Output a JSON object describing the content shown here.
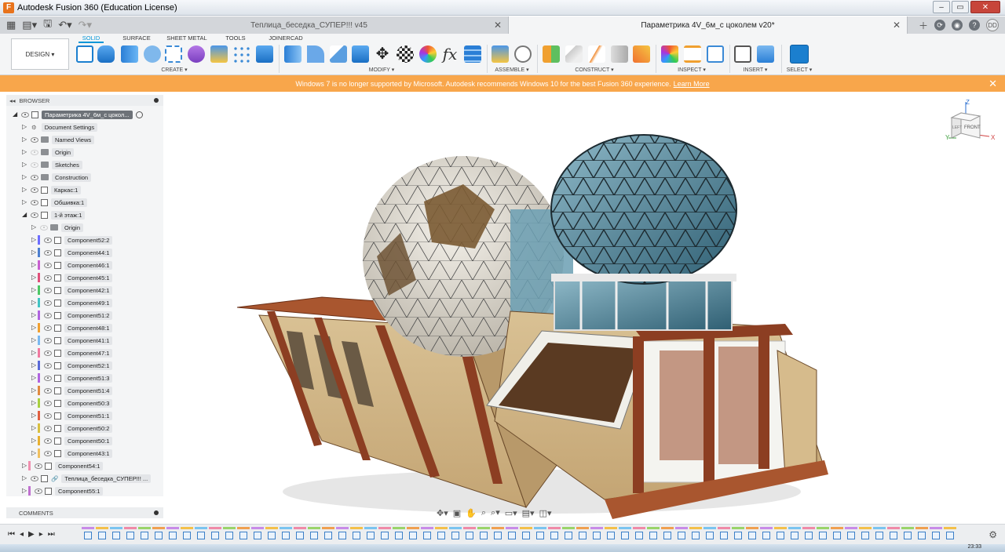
{
  "window": {
    "title": "Autodesk Fusion 360 (Education License)",
    "app_letter": "F"
  },
  "tabs": [
    {
      "label": "Теплица_беседка_СУПЕР!!! v45",
      "active": false
    },
    {
      "label": "Параметрика 4V_6м_с цоколем v20*",
      "active": true
    }
  ],
  "user": {
    "initials": "DD"
  },
  "ribbon": {
    "workspace": "DESIGN ▾",
    "tabs": [
      "SOLID",
      "SURFACE",
      "SHEET METAL",
      "TOOLS",
      "JOINERCAD"
    ],
    "groups": [
      "CREATE ▾",
      "MODIFY ▾",
      "ASSEMBLE ▾",
      "CONSTRUCT ▾",
      "INSPECT ▾",
      "INSERT ▾",
      "SELECT ▾"
    ]
  },
  "banner": {
    "text": "Windows 7 is no longer supported by Microsoft. Autodesk recommends Windows 10 for the best Fusion 360 experience.",
    "link": "Learn More",
    "close": "✕"
  },
  "browser": {
    "title": "BROWSER",
    "root": "Параметрика 4V_6м_с цокол...",
    "items": [
      {
        "label": "Document Settings",
        "type": "gear",
        "indent": 1,
        "expanded": false
      },
      {
        "label": "Named Views",
        "type": "folder",
        "indent": 1,
        "expanded": false
      },
      {
        "label": "Origin",
        "type": "folder",
        "indent": 1,
        "expanded": false,
        "hidden": true
      },
      {
        "label": "Sketches",
        "type": "folder",
        "indent": 1,
        "expanded": false,
        "hidden": true
      },
      {
        "label": "Construction",
        "type": "folder",
        "indent": 1,
        "expanded": false
      },
      {
        "label": "Каркас:1",
        "type": "comp",
        "indent": 1,
        "expanded": false
      },
      {
        "label": "Обшивка:1",
        "type": "comp",
        "indent": 1,
        "expanded": false
      },
      {
        "label": "1-й этаж:1",
        "type": "comp",
        "indent": 1,
        "expanded": true
      },
      {
        "label": "Origin",
        "type": "folder",
        "indent": 2,
        "expanded": false,
        "hidden": true
      },
      {
        "label": "Component52:2",
        "type": "comp",
        "indent": 2,
        "color": "#6d6dff"
      },
      {
        "label": "Component44:1",
        "type": "comp",
        "indent": 2,
        "color": "#4d7fcf"
      },
      {
        "label": "Component46:1",
        "type": "comp",
        "indent": 2,
        "color": "#c85fd0"
      },
      {
        "label": "Component45:1",
        "type": "comp",
        "indent": 2,
        "color": "#e0507a"
      },
      {
        "label": "Component42:1",
        "type": "comp",
        "indent": 2,
        "color": "#4cc765"
      },
      {
        "label": "Component49:1",
        "type": "comp",
        "indent": 2,
        "color": "#43c4c4"
      },
      {
        "label": "Component51:2",
        "type": "comp",
        "indent": 2,
        "color": "#b064e0"
      },
      {
        "label": "Component48:1",
        "type": "comp",
        "indent": 2,
        "color": "#f0a030"
      },
      {
        "label": "Component41:1",
        "type": "comp",
        "indent": 2,
        "color": "#7ab8f0"
      },
      {
        "label": "Component47:1",
        "type": "comp",
        "indent": 2,
        "color": "#f07aa0"
      },
      {
        "label": "Component52:1",
        "type": "comp",
        "indent": 2,
        "color": "#5a6ad8"
      },
      {
        "label": "Component51:3",
        "type": "comp",
        "indent": 2,
        "color": "#b064e0"
      },
      {
        "label": "Component51:4",
        "type": "comp",
        "indent": 2,
        "color": "#e08a40"
      },
      {
        "label": "Component50:3",
        "type": "comp",
        "indent": 2,
        "color": "#a8d040"
      },
      {
        "label": "Component51:1",
        "type": "comp",
        "indent": 2,
        "color": "#e06040"
      },
      {
        "label": "Component50:2",
        "type": "comp",
        "indent": 2,
        "color": "#d8c040"
      },
      {
        "label": "Component50:1",
        "type": "comp",
        "indent": 2,
        "color": "#e8b030"
      },
      {
        "label": "Component43:1",
        "type": "comp",
        "indent": 2,
        "color": "#f0c060"
      },
      {
        "label": "Component54:1",
        "type": "comp",
        "indent": 1,
        "color": "#f090b0"
      },
      {
        "label": "Теплица_беседка_СУПЕР!!! ...",
        "type": "link",
        "indent": 1
      },
      {
        "label": "Component55:1",
        "type": "comp",
        "indent": 1,
        "color": "#c070d0"
      }
    ]
  },
  "comments": {
    "title": "COMMENTS"
  },
  "viewcube": {
    "z": "Z",
    "x": "X",
    "y": "Y",
    "front": "FRONT",
    "left": "LEFT"
  },
  "clock": "23:33"
}
